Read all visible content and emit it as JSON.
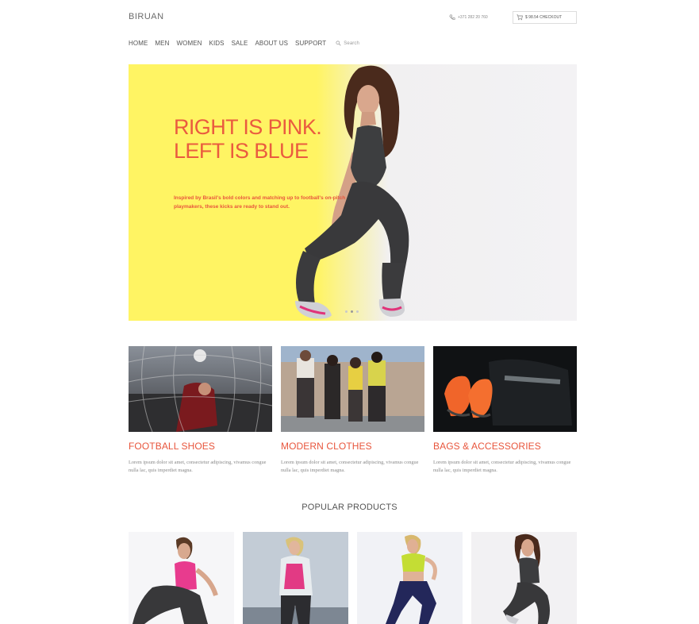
{
  "header": {
    "logo": "BIRUAN",
    "phone": "+371 282 20 760",
    "checkout": "$ 98.54 CHECKOUT"
  },
  "nav": {
    "items": [
      "HOME",
      "MEN",
      "WOMEN",
      "KIDS",
      "SALE",
      "ABOUT US",
      "SUPPORT"
    ],
    "search_placeholder": "Search"
  },
  "hero": {
    "title_line1": "RIGHT IS PINK.",
    "title_line2": "LEFT IS BLUE",
    "subtitle": "Inspired by Brasil's bold colors and matching up to football's on-pitch playmakers, these kicks are ready to stand out.",
    "slides": 3,
    "active_slide": 2
  },
  "categories": [
    {
      "title": "FOOTBALL SHOES",
      "text": "Lorem ipsum dolor sit amet, consectetur adipiscing, vivamus congue nulla lac, quis imperdiet magna."
    },
    {
      "title": "MODERN CLOTHES",
      "text": "Lorem ipsum dolor sit amet, consectetur adipiscing, vivamus congue nulla lac, quis imperdiet magna."
    },
    {
      "title": "BAGS & ACCESSORIES",
      "text": "Lorem ipsum dolor sit amet, consectetur adipiscing, vivamus congue nulla lac, quis imperdiet magna."
    }
  ],
  "popular": {
    "title": "POPULAR PRODUCTS"
  },
  "colors": {
    "accent": "#e8553c",
    "hero_yellow": "#fff463"
  }
}
